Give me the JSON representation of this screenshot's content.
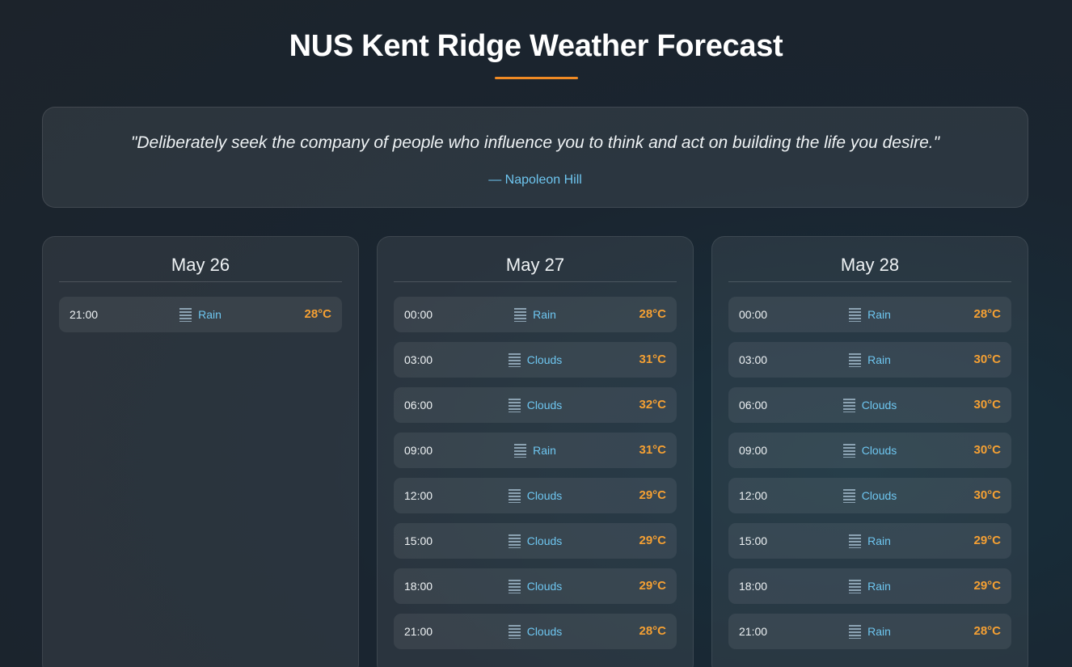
{
  "header": {
    "title": "NUS Kent Ridge Weather Forecast"
  },
  "quote": {
    "text": "\"Deliberately seek the company of people who influence you to think and act on building the life you desire.\"",
    "author": "— Napoleon Hill"
  },
  "colors": {
    "accent": "#f08a24",
    "temperature": "#f5a033",
    "condition": "#6ec6f0"
  },
  "days": [
    {
      "date": "May 26",
      "slots": [
        {
          "time": "21:00",
          "condition": "Rain",
          "temp": "28°C",
          "icon": "rain-icon"
        }
      ]
    },
    {
      "date": "May 27",
      "slots": [
        {
          "time": "00:00",
          "condition": "Rain",
          "temp": "28°C",
          "icon": "rain-icon"
        },
        {
          "time": "03:00",
          "condition": "Clouds",
          "temp": "31°C",
          "icon": "clouds-icon"
        },
        {
          "time": "06:00",
          "condition": "Clouds",
          "temp": "32°C",
          "icon": "clouds-icon"
        },
        {
          "time": "09:00",
          "condition": "Rain",
          "temp": "31°C",
          "icon": "rain-icon"
        },
        {
          "time": "12:00",
          "condition": "Clouds",
          "temp": "29°C",
          "icon": "clouds-icon"
        },
        {
          "time": "15:00",
          "condition": "Clouds",
          "temp": "29°C",
          "icon": "clouds-icon"
        },
        {
          "time": "18:00",
          "condition": "Clouds",
          "temp": "29°C",
          "icon": "clouds-icon"
        },
        {
          "time": "21:00",
          "condition": "Clouds",
          "temp": "28°C",
          "icon": "clouds-icon"
        }
      ]
    },
    {
      "date": "May 28",
      "slots": [
        {
          "time": "00:00",
          "condition": "Rain",
          "temp": "28°C",
          "icon": "rain-icon"
        },
        {
          "time": "03:00",
          "condition": "Rain",
          "temp": "30°C",
          "icon": "rain-icon"
        },
        {
          "time": "06:00",
          "condition": "Clouds",
          "temp": "30°C",
          "icon": "clouds-icon"
        },
        {
          "time": "09:00",
          "condition": "Clouds",
          "temp": "30°C",
          "icon": "clouds-icon"
        },
        {
          "time": "12:00",
          "condition": "Clouds",
          "temp": "30°C",
          "icon": "clouds-icon"
        },
        {
          "time": "15:00",
          "condition": "Rain",
          "temp": "29°C",
          "icon": "rain-icon"
        },
        {
          "time": "18:00",
          "condition": "Rain",
          "temp": "29°C",
          "icon": "rain-icon"
        },
        {
          "time": "21:00",
          "condition": "Rain",
          "temp": "28°C",
          "icon": "rain-icon"
        }
      ]
    }
  ]
}
